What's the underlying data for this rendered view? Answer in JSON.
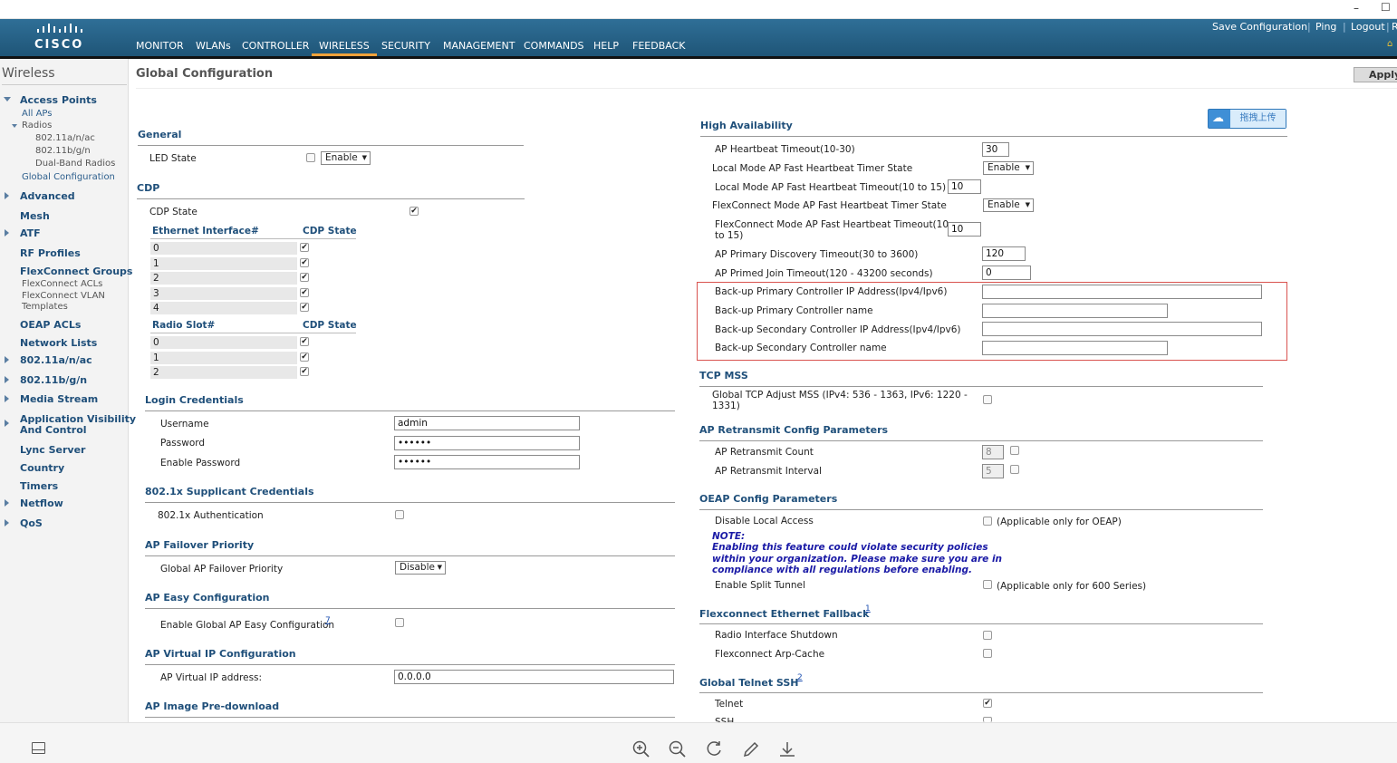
{
  "window": {
    "minimize_glyph": "–",
    "maximize_glyph": "☐"
  },
  "header": {
    "logo_text": "cisco",
    "nav": [
      "MONITOR",
      "WLANs",
      "CONTROLLER",
      "WIRELESS",
      "SECURITY",
      "MANAGEMENT",
      "COMMANDS",
      "HELP",
      "FEEDBACK"
    ],
    "active_nav": "WIRELESS",
    "links": {
      "save": "Save Configuration",
      "ping": "Ping",
      "logout": "Logout",
      "refresh": "R"
    }
  },
  "sidebar": {
    "title": "Wireless",
    "access_points": "Access Points",
    "all_aps": "All APs",
    "radios": "Radios",
    "radio_items": [
      "802.11a/n/ac",
      "802.11b/g/n",
      "Dual-Band Radios"
    ],
    "global_config": "Global Configuration",
    "advanced": "Advanced",
    "mesh": "Mesh",
    "atf": "ATF",
    "rf_profiles": "RF Profiles",
    "flexconnect_groups": "FlexConnect Groups",
    "flexconnect_acls": "FlexConnect ACLs",
    "flexconnect_vlan": "FlexConnect VLAN",
    "templates": "Templates",
    "oeap_acls": "OEAP ACLs",
    "network_lists": "Network Lists",
    "a_n_ac": "802.11a/n/ac",
    "b_g_n": "802.11b/g/n",
    "media_stream": "Media Stream",
    "avc_line1": "Application Visibility",
    "avc_line2": "And Control",
    "lync": "Lync Server",
    "country": "Country",
    "timers": "Timers",
    "netflow": "Netflow",
    "qos": "QoS"
  },
  "page": {
    "title": "Global Configuration",
    "apply": "Apply",
    "upload_button": "拖拽上传"
  },
  "general": {
    "title": "General",
    "led_label": "LED State",
    "led_value": "Enable"
  },
  "cdp": {
    "title": "CDP",
    "state_label": "CDP State",
    "eth_header": "Ethernet Interface#",
    "state_header": "CDP State",
    "eth_rows": [
      "0",
      "1",
      "2",
      "3",
      "4"
    ],
    "radio_header": "Radio Slot#",
    "radio_state_header": "CDP State",
    "radio_rows": [
      "0",
      "1",
      "2"
    ]
  },
  "login": {
    "title": "Login Credentials",
    "username_label": "Username",
    "username": "admin",
    "password_label": "Password",
    "password": "••••••",
    "enable_label": "Enable Password",
    "enable_password": "••••••"
  },
  "supplicant": {
    "title": "802.1x Supplicant Credentials",
    "auth_label": "802.1x Authentication"
  },
  "failover": {
    "title": "AP Failover Priority",
    "label": "Global AP Failover Priority",
    "value": "Disable"
  },
  "easy": {
    "title": "AP Easy Configuration",
    "label": "Enable Global AP Easy Configuration",
    "sup": "7"
  },
  "vip": {
    "title": "AP Virtual IP Configuration",
    "label": "AP Virtual IP address:",
    "value": "0.0.0.0"
  },
  "predownload": {
    "title": "AP Image Pre-download"
  },
  "ha": {
    "title": "High Availability",
    "hb_label": "AP Heartbeat Timeout(10-30)",
    "hb_value": "30",
    "lm_state_label": "Local Mode AP Fast Heartbeat Timer State",
    "lm_state": "Enable",
    "lm_timeout_label": "Local Mode AP Fast Heartbeat Timeout(10 to 15)",
    "lm_timeout": "10",
    "fc_state_label": "FlexConnect Mode AP Fast Heartbeat Timer State",
    "fc_state": "Enable",
    "fc_timeout_label1": "FlexConnect Mode AP Fast Heartbeat Timeout(10",
    "fc_timeout_label2": "to 15)",
    "fc_timeout": "10",
    "disc_label": "AP Primary Discovery Timeout(30 to 3600)",
    "disc_value": "120",
    "join_label": "AP Primed Join Timeout(120 - 43200 seconds)",
    "join_value": "0",
    "bp_ip_label": "Back-up Primary Controller IP Address(Ipv4/Ipv6)",
    "bp_name_label": "Back-up Primary Controller name",
    "bs_ip_label": "Back-up Secondary Controller IP Address(Ipv4/Ipv6)",
    "bs_name_label": "Back-up Secondary Controller name"
  },
  "tcp": {
    "title": "TCP MSS",
    "label1": "Global TCP Adjust MSS (IPv4: 536 - 1363, IPv6: 1220 -",
    "label2": "1331)"
  },
  "retransmit": {
    "title": "AP Retransmit Config Parameters",
    "count_label": "AP Retransmit Count",
    "count": "8",
    "interval_label": "AP Retransmit Interval",
    "interval": "5"
  },
  "oeap": {
    "title": "OEAP Config Parameters",
    "disable_label": "Disable Local Access",
    "disable_note": "(Applicable only for OEAP)",
    "note_title": "NOTE:",
    "note1": "Enabling this feature could violate security policies",
    "note2": "within your organization. Please make sure you are in",
    "note3": "compliance with all regulations before enabling.",
    "split_label": "Enable Split Tunnel",
    "split_note": "(Applicable only for 600 Series)"
  },
  "fallback": {
    "title": "Flexconnect Ethernet Fallback",
    "sup": "1",
    "radio_label": "Radio Interface Shutdown",
    "arp_label": "Flexconnect Arp-Cache"
  },
  "telnet": {
    "title": "Global Telnet SSH",
    "sup": "2",
    "telnet_label": "Telnet",
    "ssh_label": "SSH"
  },
  "toolbar": {
    "panel_icon": "panel-icon",
    "zoom_in": "zoom-in-icon",
    "zoom_out": "zoom-out-icon",
    "rotate": "rotate-icon",
    "edit": "pencil-icon",
    "download": "download-icon"
  }
}
